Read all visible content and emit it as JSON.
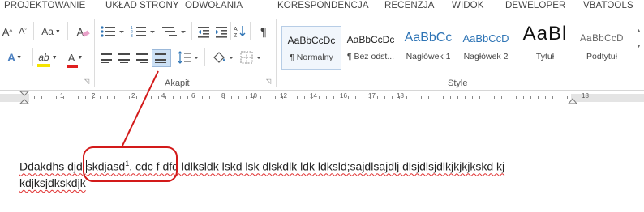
{
  "menu_tabs": [
    "PROJEKTOWANIE",
    "UKŁAD STRONY",
    "ODWOŁANIA",
    "KORESPONDENCJA",
    "RECENZJA",
    "WIDOK",
    "DEWELOPER",
    "VBATOOLS"
  ],
  "ribbon": {
    "font_buttons": {
      "grow": "A",
      "grow_sup": "^",
      "case": "Aa",
      "clear": "A",
      "highlight": "ab",
      "font_color": "A"
    },
    "paragraph_group_label": "Akapit",
    "style_group_label": "Style",
    "styles": [
      {
        "preview": "AaBbCcDc",
        "name": "¶ Normalny",
        "selected": true
      },
      {
        "preview": "AaBbCcDc",
        "name": "¶ Bez odst...",
        "selected": false
      },
      {
        "preview": "AaBbCc",
        "name": "Nagłówek 1",
        "selected": false
      },
      {
        "preview": "AaBbCcD",
        "name": "Nagłówek 2",
        "selected": false
      },
      {
        "preview": "AaBl",
        "name": "Tytuł",
        "selected": false
      },
      {
        "preview": "AaBbCcD",
        "name": "Podtytuł",
        "selected": false
      }
    ],
    "colors": {
      "highlight": "#f5e400",
      "font_color": "#e02020",
      "heading_blue": "#2e74b5",
      "selection_blue": "#cde1f5",
      "annotation_red": "#d31a1a"
    },
    "icons": [
      "grow-font-icon",
      "change-case-icon",
      "clear-formatting-icon",
      "text-effects-icon",
      "highlight-icon",
      "font-color-icon",
      "align-left-icon",
      "align-center-icon",
      "align-right-icon",
      "justify-icon",
      "line-spacing-icon",
      "shading-icon",
      "borders-icon",
      "sort-icon",
      "show-marks-icon"
    ],
    "marks_glyph": "¶"
  },
  "ruler": {
    "numbers": [
      "1",
      "2",
      "1",
      "2",
      "3",
      "4",
      "5",
      "6",
      "7",
      "8",
      "9",
      "10",
      "11",
      "12",
      "13",
      "14",
      "15",
      "16",
      "17",
      "18"
    ]
  },
  "document": {
    "line1_before": "Ddakdhs dj",
    "line1_d": "d ",
    "line1_word": "skdjasd",
    "line1_sup": "1",
    "line1_after": ". cdc f dfd ldlksldk lskd lsk dlskdlk ldk ldksld;sajdlsajdlj dlsjdlsjdlkjkjkjkskd kj",
    "line2": "kdjksjdkskdjk"
  }
}
